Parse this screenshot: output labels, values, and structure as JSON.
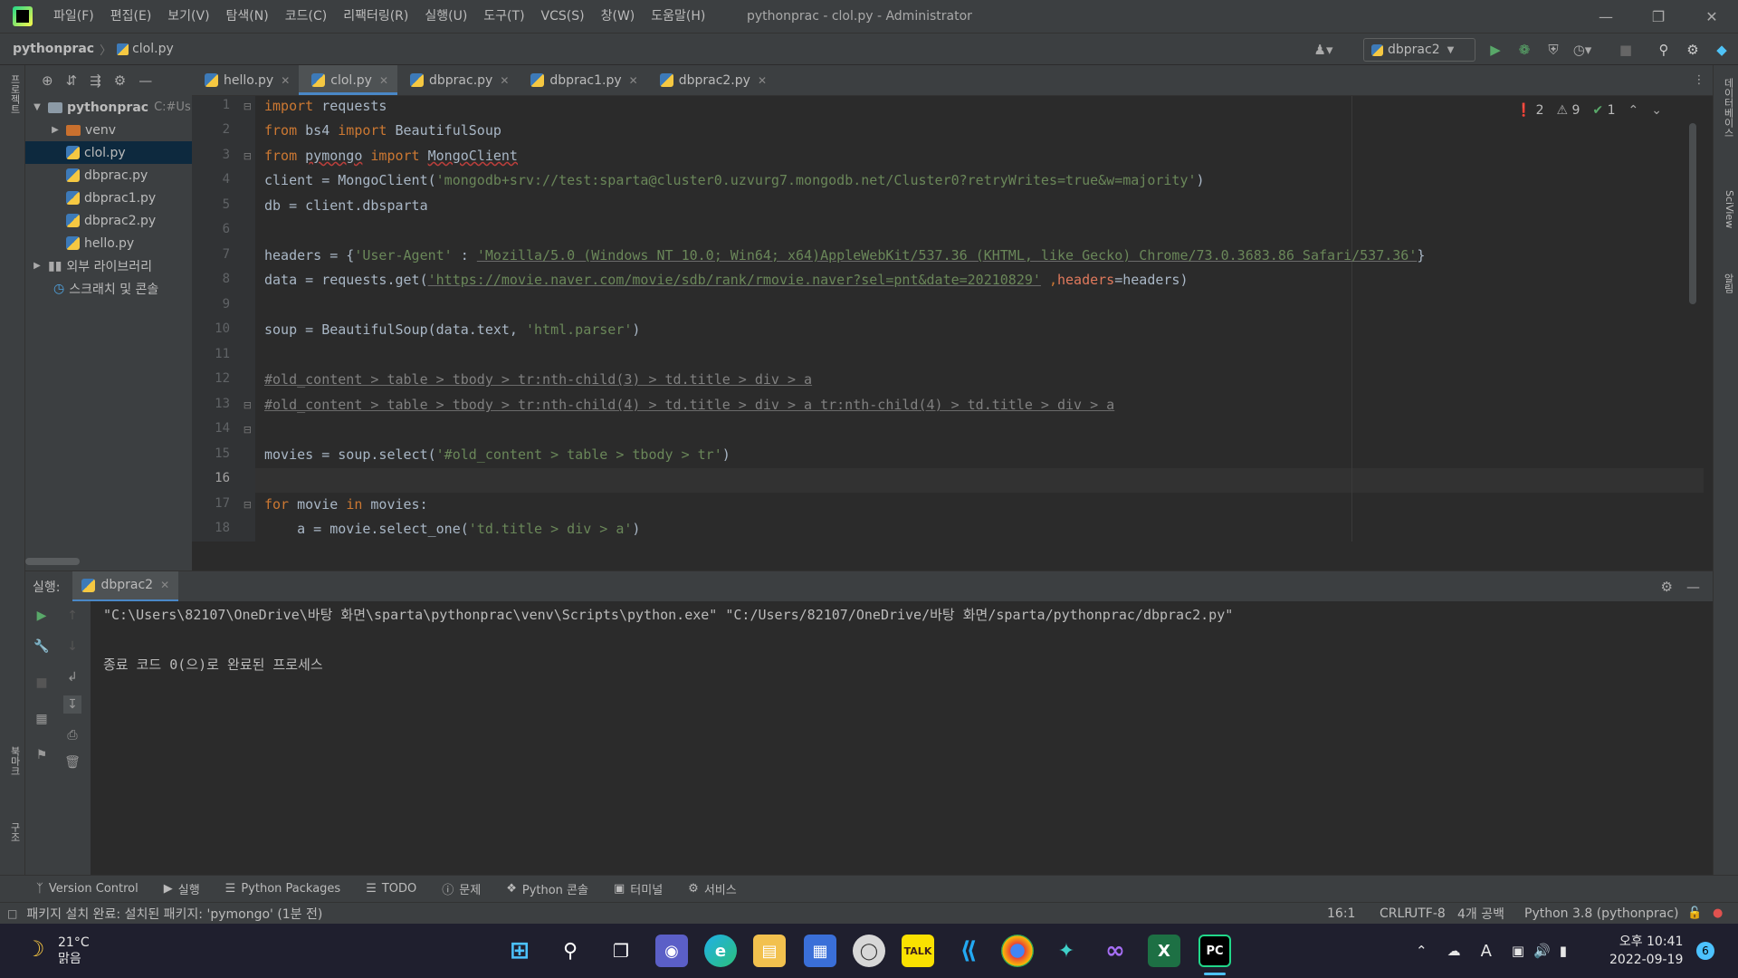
{
  "app": {
    "window_title": "pythonprac - clol.py - Administrator",
    "menu": [
      "파일(F)",
      "편집(E)",
      "보기(V)",
      "탐색(N)",
      "코드(C)",
      "리팩터링(R)",
      "실행(U)",
      "도구(T)",
      "VCS(S)",
      "창(W)",
      "도움말(H)"
    ]
  },
  "breadcrumb": {
    "project": "pythonprac",
    "file": "clol.py"
  },
  "run_config": {
    "name": "dbprac2"
  },
  "left_strip": {
    "project_label": "프로젝트",
    "bookmarks_label": "북마크",
    "structure_label": "구조"
  },
  "right_strip": {
    "db_label": "데이터베이스",
    "sciview_label": "SciView",
    "notify_label": "알림"
  },
  "project_tree": {
    "root": "pythonprac",
    "root_hint": "C:#Us",
    "items": [
      {
        "label": "venv",
        "type": "folder"
      },
      {
        "label": "clol.py",
        "type": "py",
        "selected": true
      },
      {
        "label": "dbprac.py",
        "type": "py"
      },
      {
        "label": "dbprac1.py",
        "type": "py"
      },
      {
        "label": "dbprac2.py",
        "type": "py"
      }
    ],
    "hello": "hello.py",
    "external_libs": "외부 라이브러리",
    "scratches": "스크래치 및 콘솔"
  },
  "tabs": [
    {
      "label": "hello.py"
    },
    {
      "label": "clol.py",
      "active": true
    },
    {
      "label": "dbprac.py"
    },
    {
      "label": "dbprac1.py"
    },
    {
      "label": "dbprac2.py"
    }
  ],
  "inspections": {
    "errors": "2",
    "warnings": "9",
    "ok": "1"
  },
  "code": {
    "line_numbers": [
      "1",
      "2",
      "3",
      "4",
      "5",
      "6",
      "7",
      "8",
      "9",
      "10",
      "11",
      "12",
      "13",
      "14",
      "15",
      "16",
      "17",
      "18"
    ],
    "current_line": "16",
    "l1_kw": "import",
    "l1_rest": " requests",
    "l2_kw1": "from",
    "l2_mid": " bs4 ",
    "l2_kw2": "import",
    "l2_rest": " BeautifulSoup",
    "l3_kw1": "from",
    "l3_mod": "pymongo",
    "l3_kw2": "import",
    "l3_rest": "MongoClient",
    "l4_a": "client = MongoClient(",
    "l4_str": "'mongodb+srv://test:sparta@cluster0.uzvurg7.mongodb.net/Cluster0?retryWrites=true&w=majority'",
    "l4_b": ")",
    "l5": "db = client.dbsparta",
    "l7_a": "headers = {",
    "l7_key": "'User-Agent'",
    "l7_sep": " : ",
    "l7_val": "'Mozilla/5.0 (Windows NT 10.0; Win64; x64)AppleWebKit/537.36 (KHTML, like Gecko) Chrome/73.0.3683.86 Safari/537.36'",
    "l7_b": "}",
    "l8_a": "data = requests.get(",
    "l8_url": "'https://movie.naver.com/movie/sdb/rank/rmovie.naver?sel=pnt&date=20210829'",
    "l8_comma": " ,",
    "l8_param": "headers",
    "l8_b": "=headers)",
    "l10_a": "soup = BeautifulSoup(data.text, ",
    "l10_str": "'html.parser'",
    "l10_b": ")",
    "l12": "#old_content > table > tbody > tr:nth-child(3) > td.title > div > a",
    "l13": "#old_content > table > tbody > tr:nth-child(4) > td.title > div > a tr:nth-child(4) > td.title > div > a",
    "l15_a": "movies = soup.select(",
    "l15_str": "'#old_content > table > tbody > tr'",
    "l15_b": ")",
    "l17_kw1": "for",
    "l17_mid": " movie ",
    "l17_kw2": "in",
    "l17_rest": " movies:",
    "l18_a": "    a = movie.select_one(",
    "l18_str": "'td.title > div > a'",
    "l18_b": ")"
  },
  "run_panel": {
    "label": "실행:",
    "tab": "dbprac2",
    "command": "\"C:\\Users\\82107\\OneDrive\\바탕 화면\\sparta\\pythonprac\\venv\\Scripts\\python.exe\" \"C:/Users/82107/OneDrive/바탕 화면/sparta/pythonprac/dbprac2.py\"",
    "exit_message": "종료 코드 0(으)로 완료된 프로세스"
  },
  "tool_tabs": [
    "Version Control",
    "실행",
    "Python Packages",
    "TODO",
    "문제",
    "Python 콘솔",
    "터미널",
    "서비스"
  ],
  "status": {
    "message": "패키지 설치 완료: 설치된 패키지: 'pymongo' (1분 전)",
    "position": "16:1",
    "line_sep": "CRLF",
    "encoding": "UTF-8",
    "indent": "4개 공백",
    "interpreter": "Python 3.8 (pythonprac)"
  },
  "taskbar": {
    "weather_temp": "21°C",
    "weather_desc": "맑음",
    "time": "오후 10:41",
    "date": "2022-09-19",
    "notifications": "6",
    "ime": "A",
    "kakao": "TALK",
    "pycharm": "PC"
  },
  "colors": {
    "accent": "#4a88c7",
    "keyword": "#cc7832",
    "string": "#6a8759",
    "comment": "#808080",
    "error": "#bc3f3c"
  }
}
